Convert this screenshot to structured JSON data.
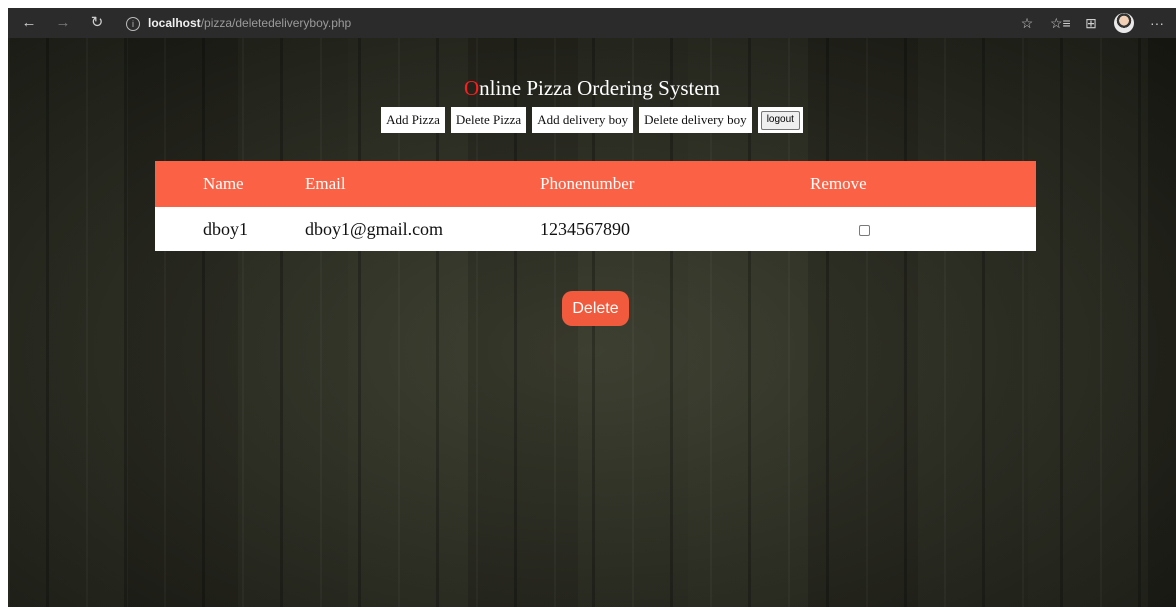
{
  "browser": {
    "url_host": "localhost",
    "url_path": "/pizza/deletedeliveryboy.php"
  },
  "header": {
    "title_first": "O",
    "title_rest": "nline Pizza Ordering System"
  },
  "nav": {
    "items": [
      "Add Pizza",
      "Delete Pizza",
      "Add delivery boy",
      "Delete delivery boy"
    ],
    "logout": "logout"
  },
  "table": {
    "headers": [
      "Name",
      "Email",
      "Phonenumber",
      "Remove"
    ],
    "rows": [
      {
        "name": "dboy1",
        "email": "dboy1@gmail.com",
        "phone": "1234567890",
        "remove": false
      }
    ]
  },
  "actions": {
    "delete": "Delete"
  },
  "colors": {
    "accent": "#fb6245",
    "title_first": "#ff1c1c"
  }
}
